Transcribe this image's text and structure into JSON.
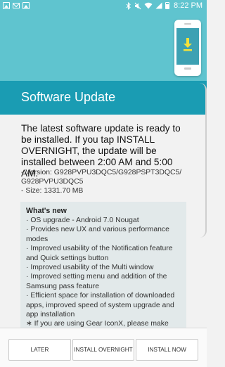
{
  "status_bar": {
    "time": "8:22 PM",
    "battery_level_percent": 80,
    "icons": [
      "image-icon",
      "mail-icon",
      "image-icon",
      "bluetooth-icon",
      "mute-icon",
      "wifi-icon",
      "signal-icon",
      "battery-icon"
    ]
  },
  "header": {
    "title": "Software Update",
    "accent_color": "#5fc4cf",
    "title_band_color": "#1a9cb3",
    "icon": "phone-download-icon"
  },
  "main": {
    "intro": "The latest software update is ready to be installed. If you tap INSTALL OVERNIGHT, the update will be installed between 2:00 AM and 5:00 AM.",
    "version": " - Version: G928PVPU3DQC5/G928PSPT3DQC5/ G928PVPU3DQC5",
    "size": " - Size: 1331.70 MB",
    "whats_new": {
      "title": "What's new",
      "items": [
        "· OS upgrade - Android 7.0 Nougat",
        "· Provides new UX and various performance modes",
        "· Improved usability of the Notification feature and Quick settings button",
        "· Improved usability of the Multi window",
        "· Improved setting menu and addition of the Samsung pass feature",
        "· Efficient space for installation of downloaded apps, improved speed of system upgrade and app installation",
        "∗ If you are using Gear IconX, please make"
      ]
    }
  },
  "buttons": {
    "later": "LATER",
    "install_overnight": "INSTALL OVERNIGHT",
    "install_now": "INSTALL NOW"
  }
}
